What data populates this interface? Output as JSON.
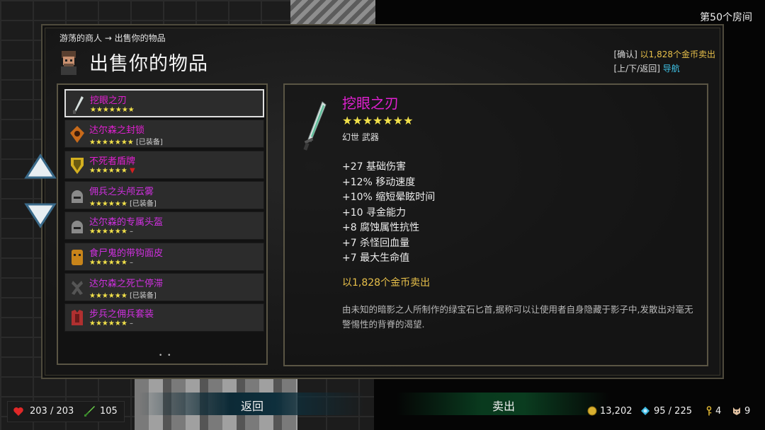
{
  "room": "第50个房间",
  "breadcrumb": "游荡的商人 → 出售你的物品",
  "title": "出售你的物品",
  "hints": {
    "confirm_key": "[确认]",
    "confirm_text": "以1,828个金币卖出",
    "nav_key": "[上/下/返回]",
    "nav_text": "导航"
  },
  "items": [
    {
      "name": "挖眼之刃",
      "stars": "★★★★★★★",
      "tag": "",
      "name_color": "#e020d0",
      "icon": "dagger-icon"
    },
    {
      "name": "达尔森之封锁",
      "stars": "★★★★★★★",
      "tag": "[已装备]",
      "name_color": "#e020d0",
      "icon": "amulet-icon"
    },
    {
      "name": "不死者盾牌",
      "stars": "★★★★★★",
      "tag": "▼",
      "name_color": "#e020d0",
      "icon": "shield-icon"
    },
    {
      "name": "佣兵之头颅云雾",
      "stars": "★★★★★★",
      "tag": "[已装备]",
      "name_color": "#d030e0",
      "icon": "helmet-icon"
    },
    {
      "name": "达尔森的专属头盔",
      "stars": "★★★★★★",
      "tag": "–",
      "name_color": "#d030e0",
      "icon": "helmet-icon"
    },
    {
      "name": "食尸鬼的带钩面皮",
      "stars": "★★★★★★",
      "tag": "–",
      "name_color": "#d030e0",
      "icon": "mask-icon"
    },
    {
      "name": "达尔森之死亡停滞",
      "stars": "★★★★★★",
      "tag": "[已装备]",
      "name_color": "#d030e0",
      "icon": "gloves-icon"
    },
    {
      "name": "步兵之佣兵套装",
      "stars": "★★★★★★",
      "tag": "–",
      "name_color": "#d030e0",
      "icon": "armor-icon"
    }
  ],
  "page_dots": "• •",
  "detail": {
    "name": "挖眼之刃",
    "stars": "★★★★★★★",
    "type": "幻世 武器",
    "stats": [
      "+27 基础伤害",
      "+12% 移动速度",
      "+10% 缩短晕眩时间",
      "+10 寻金能力",
      "+8 腐蚀属性抗性",
      "+7 杀怪回血量",
      "+7 最大生命值"
    ],
    "price": "以1,828个金币卖出",
    "description": "由未知的暗影之人所制作的绿宝石匕首,据称可以让使用者自身隐藏于影子中,发散出对毫无警惕性的背脊的渴望."
  },
  "buttons": {
    "back": "返回",
    "sell": "卖出"
  },
  "player": {
    "hp": "203 / 203",
    "attack": "105"
  },
  "resources": {
    "gold": "13,202",
    "gems": "95 / 225",
    "keys": "4",
    "pets": "9"
  },
  "colors": {
    "epic": "#e020d0",
    "gold": "#e8c04a",
    "cyan": "#3fc4e8",
    "stars": "#f2e14a"
  }
}
